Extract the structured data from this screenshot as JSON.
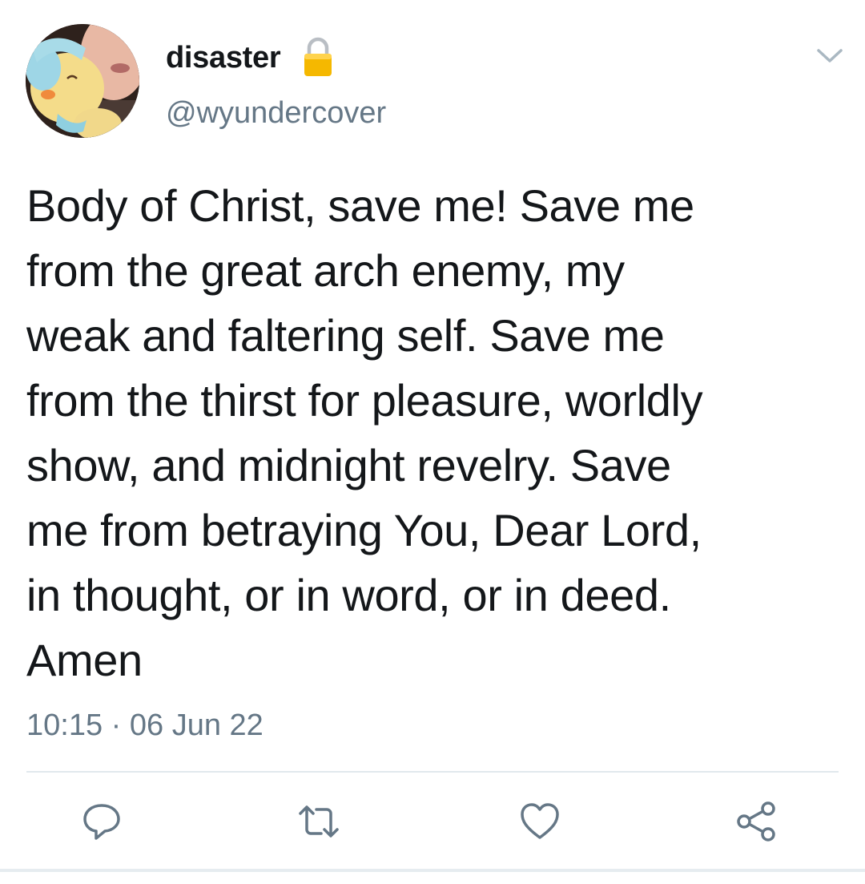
{
  "author": {
    "display_name": "disaster",
    "handle": "@wyundercover",
    "protected_icon": "lock-icon",
    "avatar": "avatar-photo"
  },
  "tweet": {
    "lines": [
      "Body of Christ, save me! Save me",
      "from the great arch enemy, my",
      "weak and faltering self. Save me",
      "from the thirst for pleasure, worldly",
      "show, and midnight revelry. Save",
      "me from betraying You, Dear Lord,",
      "in thought, or in word, or in deed.",
      "Amen"
    ],
    "timestamp": "10:15 · 06 Jun 22"
  },
  "actions": [
    {
      "name": "reply",
      "icon": "reply-icon"
    },
    {
      "name": "retweet",
      "icon": "retweet-icon"
    },
    {
      "name": "like",
      "icon": "heart-icon"
    },
    {
      "name": "share",
      "icon": "share-icon"
    }
  ],
  "menu_icon": "chevron-down-icon",
  "colors": {
    "text": "#14171a",
    "secondary_text": "#657786",
    "icon": "#657786",
    "divider": "#e1e8ed",
    "lock": "#f5b800"
  }
}
